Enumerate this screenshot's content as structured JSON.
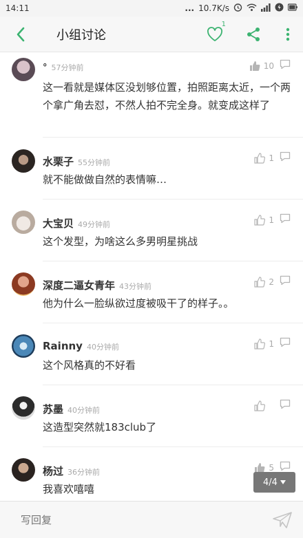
{
  "status_bar": {
    "time": "14:11",
    "dots": "...",
    "speed": "10.7K/s"
  },
  "header": {
    "title": "小组讨论",
    "like_count": "1"
  },
  "comments": [
    {
      "name": "°",
      "time": "57分钟前",
      "likes": "10",
      "text": "这一看就是媒体区没划够位置，拍照距离太近，一个两个拿广角去怼，不然人拍不完全身。就变成这样了"
    },
    {
      "name": "水栗子",
      "time": "55分钟前",
      "likes": "1",
      "text": "就不能做做自然的表情嘛…"
    },
    {
      "name": "大宝贝",
      "time": "49分钟前",
      "likes": "1",
      "text": "这个发型，为啥这么多男明星挑战"
    },
    {
      "name": "深度二逼女青年",
      "time": "43分钟前",
      "likes": "2",
      "text": "他为什么一脸纵欲过度被吸干了的样子。。"
    },
    {
      "name": "Rainny",
      "time": "40分钟前",
      "likes": "1",
      "text": "这个风格真的不好看"
    },
    {
      "name": "苏墨",
      "time": "40分钟前",
      "likes": "",
      "text": "这造型突然就183club了"
    },
    {
      "name": "杨过",
      "time": "36分钟前",
      "likes": "5",
      "text": "我喜欢嘻嘻"
    }
  ],
  "pager": {
    "label": "4/4"
  },
  "reply": {
    "placeholder": "写回复"
  },
  "colors": {
    "accent": "#3cb371",
    "icon_gray": "#b0b0b0"
  }
}
